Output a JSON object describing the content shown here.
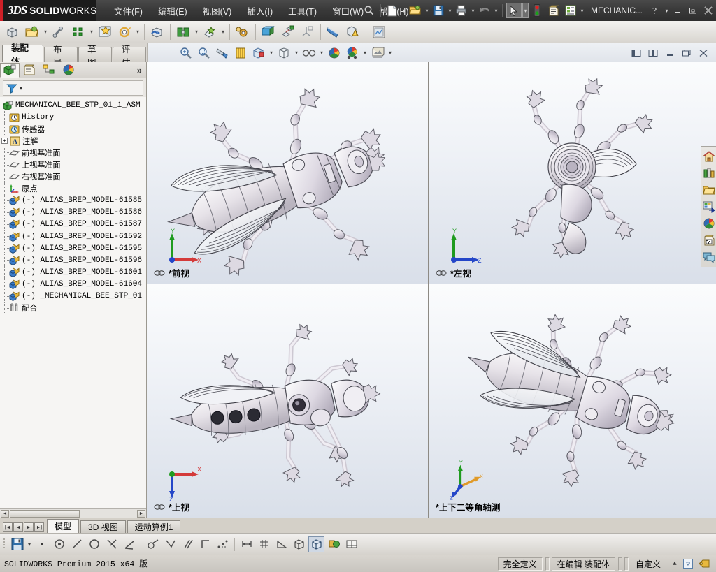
{
  "app": {
    "brand_3ds": "3DS",
    "brand_name_bold": "SOLID",
    "brand_name_thin": "WORKS",
    "document_name": "MECHANIC...",
    "accent_red": "#cf2027",
    "titlebar_bg": "#3a3a3a"
  },
  "menu": {
    "items": [
      {
        "label": "文件(F)",
        "name": "menu-file"
      },
      {
        "label": "编辑(E)",
        "name": "menu-edit"
      },
      {
        "label": "视图(V)",
        "name": "menu-view"
      },
      {
        "label": "插入(I)",
        "name": "menu-insert"
      },
      {
        "label": "工具(T)",
        "name": "menu-tools"
      },
      {
        "label": "窗口(W)",
        "name": "menu-window"
      },
      {
        "label": "帮助(H)",
        "name": "menu-help"
      }
    ]
  },
  "quickaccess": {
    "icons": [
      "search-icon",
      "new-document-icon",
      "open-folder-icon",
      "save-icon",
      "print-icon",
      "undo-icon",
      "select-arrow-icon",
      "rebuild-icon",
      "file-properties-icon",
      "options-icon"
    ],
    "help_icon": "help-question-icon",
    "minimize": "minimize-icon",
    "restore": "restore-icon",
    "close": "close-icon"
  },
  "toolbar": {
    "icons": [
      "insert-components-icon",
      "edit-component-icon",
      "mate-icon",
      "linear-component-pattern-icon",
      "smart-fasteners-icon",
      "move-component-icon",
      "show-hidden-components-icon",
      "assembly-features-icon",
      "reference-geometry-icon",
      "new-motion-study-icon",
      "bill-of-materials-icon",
      "exploded-view-icon",
      "explode-line-sketch-icon",
      "interference-detection-icon",
      "clearance-verification-icon",
      "assembly-visualization-icon"
    ]
  },
  "command_tabs": {
    "items": [
      {
        "label": "装配体",
        "active": true,
        "name": "tab-assembly"
      },
      {
        "label": "布局",
        "active": false,
        "name": "tab-layout"
      },
      {
        "label": "草图",
        "active": false,
        "name": "tab-sketch"
      },
      {
        "label": "评估",
        "active": false,
        "name": "tab-evaluate"
      }
    ]
  },
  "view_toolbar": {
    "icons": [
      "zoom-to-fit-icon",
      "zoom-to-area-icon",
      "section-view-icon",
      "view-orientation-icon",
      "display-style-icon",
      "hide-show-icon",
      "apply-scene-icon",
      "view-settings-icon",
      "appearance-icon"
    ],
    "window_buttons": [
      "split-left-icon",
      "split-right-icon",
      "minimize-window-icon",
      "restore-window-icon",
      "close-window-icon"
    ]
  },
  "feature_manager": {
    "tabs": [
      {
        "name": "featuremanager-tab",
        "icon": "feature-tree-icon",
        "active": true
      },
      {
        "name": "propertymanager-tab",
        "icon": "property-manager-icon",
        "active": false
      },
      {
        "name": "configurationmanager-tab",
        "icon": "configuration-manager-icon",
        "active": false
      },
      {
        "name": "displaymanager-tab",
        "icon": "display-manager-icon",
        "active": false
      }
    ],
    "more_label": "»",
    "filter_icon": "filter-funnel-icon",
    "tree": [
      {
        "label": "MECHANICAL_BEE_STP_01_1_ASM",
        "indent": 0,
        "icon": "assembly-icon",
        "expand": "none",
        "mono": true
      },
      {
        "label": "History",
        "indent": 1,
        "icon": "history-icon",
        "expand": "none",
        "mono": true
      },
      {
        "label": "传感器",
        "indent": 1,
        "icon": "sensors-icon",
        "expand": "none",
        "mono": false
      },
      {
        "label": "注解",
        "indent": 1,
        "icon": "annotations-icon",
        "expand": "plus",
        "mono": false
      },
      {
        "label": "前视基准面",
        "indent": 1,
        "icon": "plane-icon",
        "expand": "none",
        "mono": false
      },
      {
        "label": "上视基准面",
        "indent": 1,
        "icon": "plane-icon",
        "expand": "none",
        "mono": false
      },
      {
        "label": "右视基准面",
        "indent": 1,
        "icon": "plane-icon",
        "expand": "none",
        "mono": false
      },
      {
        "label": "原点",
        "indent": 1,
        "icon": "origin-icon",
        "expand": "none",
        "mono": false
      },
      {
        "label": "(-) ALIAS_BREP_MODEL-61585",
        "indent": 1,
        "icon": "part-icon",
        "expand": "none",
        "mono": true
      },
      {
        "label": "(-) ALIAS_BREP_MODEL-61586",
        "indent": 1,
        "icon": "part-icon",
        "expand": "none",
        "mono": true
      },
      {
        "label": "(-) ALIAS_BREP_MODEL-61587",
        "indent": 1,
        "icon": "part-icon",
        "expand": "none",
        "mono": true
      },
      {
        "label": "(-) ALIAS_BREP_MODEL-61592",
        "indent": 1,
        "icon": "part-icon",
        "expand": "none",
        "mono": true
      },
      {
        "label": "(-) ALIAS_BREP_MODEL-61595",
        "indent": 1,
        "icon": "part-icon",
        "expand": "none",
        "mono": true
      },
      {
        "label": "(-) ALIAS_BREP_MODEL-61596",
        "indent": 1,
        "icon": "part-icon",
        "expand": "none",
        "mono": true
      },
      {
        "label": "(-) ALIAS_BREP_MODEL-61601",
        "indent": 1,
        "icon": "part-icon",
        "expand": "none",
        "mono": true
      },
      {
        "label": "(-) ALIAS_BREP_MODEL-61604",
        "indent": 1,
        "icon": "part-icon",
        "expand": "none",
        "mono": true
      },
      {
        "label": "(-) _MECHANICAL_BEE_STP_01",
        "indent": 1,
        "icon": "part-icon",
        "expand": "none",
        "mono": true
      },
      {
        "label": "配合",
        "indent": 1,
        "icon": "mates-icon",
        "expand": "none",
        "mono": false
      }
    ]
  },
  "viewports": [
    {
      "name": "viewport-front",
      "label": "*前视",
      "link_icon": "linked-views-icon",
      "show_link": true,
      "triad": "xy"
    },
    {
      "name": "viewport-left",
      "label": "*左视",
      "link_icon": "linked-views-icon",
      "show_link": true,
      "triad": "yz"
    },
    {
      "name": "viewport-top",
      "label": "*上视",
      "link_icon": "linked-views-icon",
      "show_link": true,
      "triad": "xz"
    },
    {
      "name": "viewport-trimetric",
      "label": "*上下二等角轴测",
      "link_icon": "linked-views-icon",
      "show_link": false,
      "triad": "iso"
    }
  ],
  "task_pane": {
    "items": [
      {
        "name": "task-home-button",
        "icon": "home-icon"
      },
      {
        "name": "task-design-library-button",
        "icon": "design-library-icon"
      },
      {
        "name": "task-file-explorer-button",
        "icon": "file-explorer-icon"
      },
      {
        "name": "task-view-palette-button",
        "icon": "view-palette-icon"
      },
      {
        "name": "task-appearances-button",
        "icon": "appearances-scenes-icon"
      },
      {
        "name": "task-custom-properties-button",
        "icon": "custom-properties-icon"
      },
      {
        "name": "task-forum-button",
        "icon": "solidworks-forum-icon"
      }
    ]
  },
  "bottom_tabs": {
    "nav": [
      "first-icon",
      "prev-icon",
      "next-icon",
      "last-icon"
    ],
    "items": [
      {
        "label": "模型",
        "active": true,
        "name": "bottom-tab-model"
      },
      {
        "label": "3D 视图",
        "active": false,
        "name": "bottom-tab-3dviews"
      },
      {
        "label": "运动算例1",
        "active": false,
        "name": "bottom-tab-motionstudy"
      }
    ]
  },
  "bottom_toolbar": {
    "icons": [
      "save-icon",
      "point-icon",
      "coincident-icon",
      "line-icon",
      "circle-icon",
      "intersection-icon",
      "angle-icon",
      "tangent-icon",
      "perpendicular-icon",
      "parallel-icon",
      "corner-icon",
      "sketch-pattern-icon",
      "dimension-icon",
      "grid-icon",
      "angle-measure-icon",
      "shaded-box-icon",
      "isometric-box-icon",
      "appearance-ball-icon",
      "table-icon"
    ]
  },
  "status_bar": {
    "version_text": "SOLIDWORKS Premium 2015 x64 版",
    "defined_state": "完全定义",
    "edit_state": "在编辑 装配体",
    "units": "自定义",
    "expand_icon": "triangle-up-icon",
    "help_icon": "help-question-icon",
    "tag_icon": "tag-icon"
  }
}
